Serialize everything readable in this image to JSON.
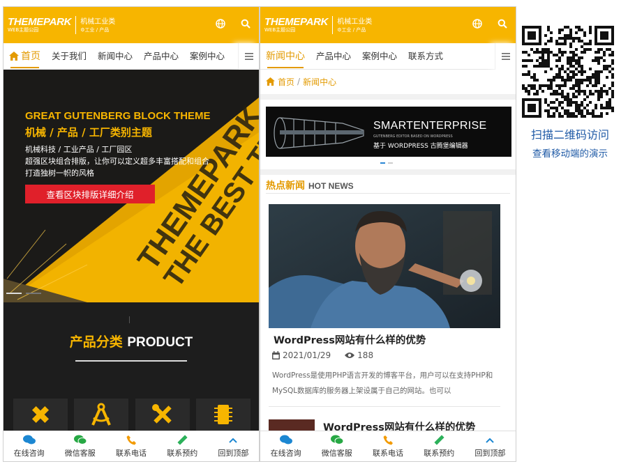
{
  "brand": {
    "logo": "THEMEPARK",
    "logo_sub": "WEB主题公园",
    "tagline": "机械工业类",
    "tagline_sub": "⚙工业 / 产品"
  },
  "left": {
    "nav": [
      "首页",
      "关于我们",
      "新闻中心",
      "产品中心",
      "案例中心"
    ],
    "hero": {
      "title_en": "GREAT GUTENBERG BLOCK THEME",
      "title_cn": "机械 / 产品 / 工厂类别主题",
      "line1": "机械科技 / 工业产品 / 工厂园区",
      "line2": "超强区块组合排版，让你可以定义超多丰富搭配和组合",
      "line3": "打造独树一帜的风格",
      "button": "查看区块排版详细介绍"
    },
    "product": {
      "title_cn": "产品分类",
      "title_en": "PRODUCT"
    }
  },
  "right": {
    "nav": [
      "新闻中心",
      "产品中心",
      "案例中心",
      "联系方式"
    ],
    "breadcrumb": {
      "home": "首页",
      "sep": "/",
      "current": "新闻中心"
    },
    "banner": {
      "title": "SMARTENTERPRISE",
      "sub1": "GUTENBERG EDITOR BASED ON WORDPRESS",
      "sub2": "基于 WORDPRESS 古腾堡编辑器"
    },
    "hot": {
      "cn": "热点新闻",
      "en": "HOT NEWS"
    },
    "post": {
      "title": "WordPress网站有什么样的优势",
      "date": "2021/01/29",
      "views": "188",
      "excerpt": "WordPress是使用PHP语言开发的博客平台，用户可以在支持PHP和MySQL数据库的服务器上架设属于自己的网站。也可以"
    },
    "post2_title": "WordPress网站有什么样的优势"
  },
  "bottom_bar": [
    "在线咨询",
    "微信客服",
    "联系电话",
    "联系预约",
    "回到顶部"
  ],
  "qr": {
    "caption1": "扫描二维码访问",
    "caption2": "查看移动端的演示"
  },
  "colors": {
    "brand_yellow": "#f7b500",
    "accent_orange": "#e39a00",
    "button_red": "#e0202a",
    "qr_text_blue": "#1f5aa6"
  }
}
